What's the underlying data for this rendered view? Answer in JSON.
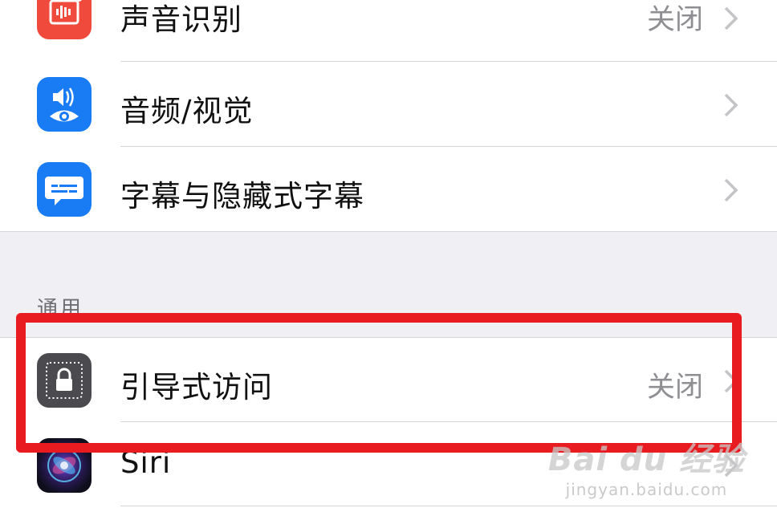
{
  "sections": {
    "hearing": {
      "items": [
        {
          "label": "声音识别",
          "value": "关闭",
          "icon": "sound-recognition-icon",
          "icon_color": "#f04a3c"
        },
        {
          "label": "音频/视觉",
          "value": "",
          "icon": "audio-visual-icon",
          "icon_color": "#1a7cf5"
        },
        {
          "label": "字幕与隐藏式字幕",
          "value": "",
          "icon": "subtitles-icon",
          "icon_color": "#1a7cf5"
        }
      ]
    },
    "general": {
      "header": "通用",
      "items": [
        {
          "label": "引导式访问",
          "value": "关闭",
          "icon": "guided-access-lock-icon",
          "icon_color": "#4a4a4f"
        },
        {
          "label": "Siri",
          "value": "",
          "icon": "siri-icon",
          "icon_color": "#1c1c2e"
        }
      ]
    }
  },
  "highlight_color": "#e81b20",
  "watermark": {
    "main": "Bai du 经验",
    "sub": "jingyan.baidu.com"
  }
}
